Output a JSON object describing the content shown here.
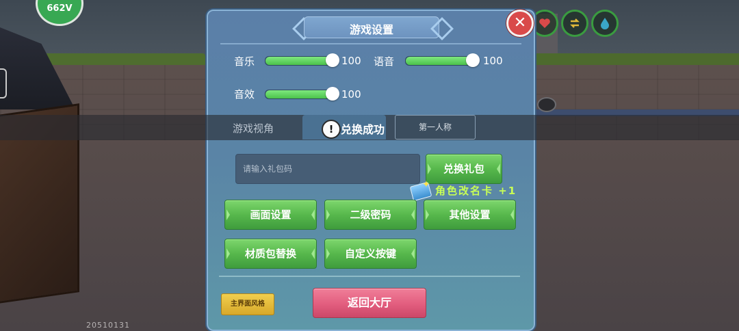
{
  "hud": {
    "avatar_text": "662V",
    "build_number": "20510131"
  },
  "dialog": {
    "title": "游戏设置",
    "close_glyph": "✕",
    "music": {
      "label": "音乐",
      "value": "100",
      "level": 1.0
    },
    "voice": {
      "label": "语音",
      "value": "100",
      "level": 1.0
    },
    "sfx": {
      "label": "音效",
      "value": "100",
      "level": 1.0
    },
    "view": {
      "label": "游戏视角",
      "first_person_label": "第一人称"
    },
    "toast": {
      "icon": "!",
      "message": "兑换成功"
    },
    "gift": {
      "placeholder": "请输入礼包码",
      "redeem_label": "兑换礼包",
      "reward_text": "角色改名卡 +1"
    },
    "buttons": {
      "graphics": "画面设置",
      "second_password": "二级密码",
      "other_settings": "其他设置",
      "texture_pack": "材质包替换",
      "custom_keys": "自定义按键"
    },
    "footer": {
      "style_label": "主界面风格",
      "return_label": "返回大厅"
    }
  },
  "colors": {
    "accent_green": "#57b84c",
    "return_pink": "#e25d7e",
    "reward_text": "#c8ff55",
    "panel_blue": "#5b7fa8"
  },
  "icons": [
    "heart-icon",
    "swap-icon",
    "water-drop-icon",
    "eye-icon",
    "close-icon",
    "alert-icon",
    "reward-card-icon"
  ]
}
